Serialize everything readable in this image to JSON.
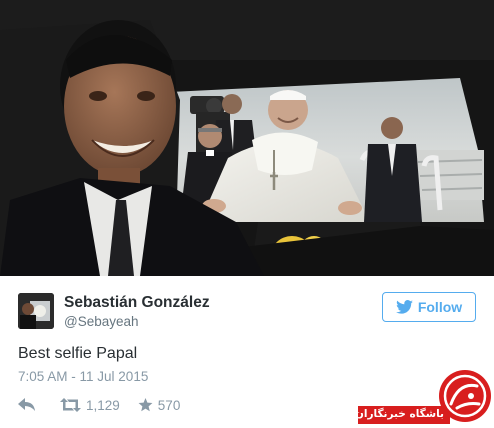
{
  "tweet": {
    "author_name": "Sebastián González",
    "author_handle": "@Sebayeah",
    "text": "Best selfie Papal",
    "timestamp": "7:05 AM - 11 Jul 2015",
    "retweets": "1,129",
    "favorites": "570"
  },
  "follow_button": {
    "label": "Follow"
  },
  "watermark": {
    "text": "باشگاه خبرنگاران"
  },
  "colors": {
    "twitter_blue": "#55acee",
    "text_dark": "#292f33",
    "text_muted": "#8899a6",
    "watermark_red": "#d81e1e"
  },
  "icons": {
    "follow": "bird-icon",
    "reply": "reply-icon",
    "retweet": "retweet-icon",
    "favorite": "star-icon"
  }
}
